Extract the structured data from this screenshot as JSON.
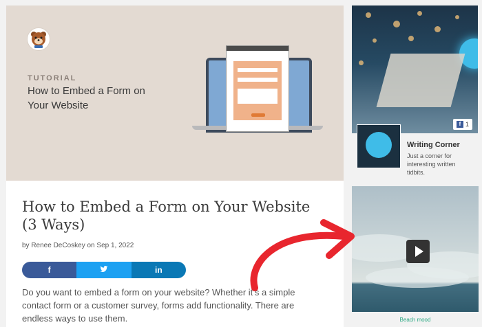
{
  "hero": {
    "eyebrow": "TUTORIAL",
    "title": "How to Embed a Form on Your Website"
  },
  "post": {
    "title": "How to Embed a Form on Your Website (3 Ways)",
    "byline": "by Renee DeCoskey on Sep 1, 2022",
    "excerpt": "Do you want to embed a form on your website? Whether it’s a simple contact form or a customer survey, forms add functionality. There are endless ways to use them."
  },
  "share": {
    "facebook": "f",
    "twitter": "🐦",
    "linkedin": "in"
  },
  "sidebar": {
    "like_count": "1",
    "group_name": "Writing Corner",
    "group_desc": "Just a corner for interesting written tidbits.",
    "video_caption": "Beach mood"
  },
  "icons": {
    "logo": "bear-mascot-icon",
    "facebook": "facebook-icon",
    "twitter": "twitter-icon",
    "linkedin": "linkedin-icon",
    "play": "play-icon",
    "arrow": "red-arrow"
  },
  "colors": {
    "hero_bg": "#e3dad2",
    "facebook": "#3a5a99",
    "twitter": "#1da1f2",
    "linkedin": "#0a78b5",
    "accent": "#e8262e",
    "caption": "#2aa883"
  }
}
